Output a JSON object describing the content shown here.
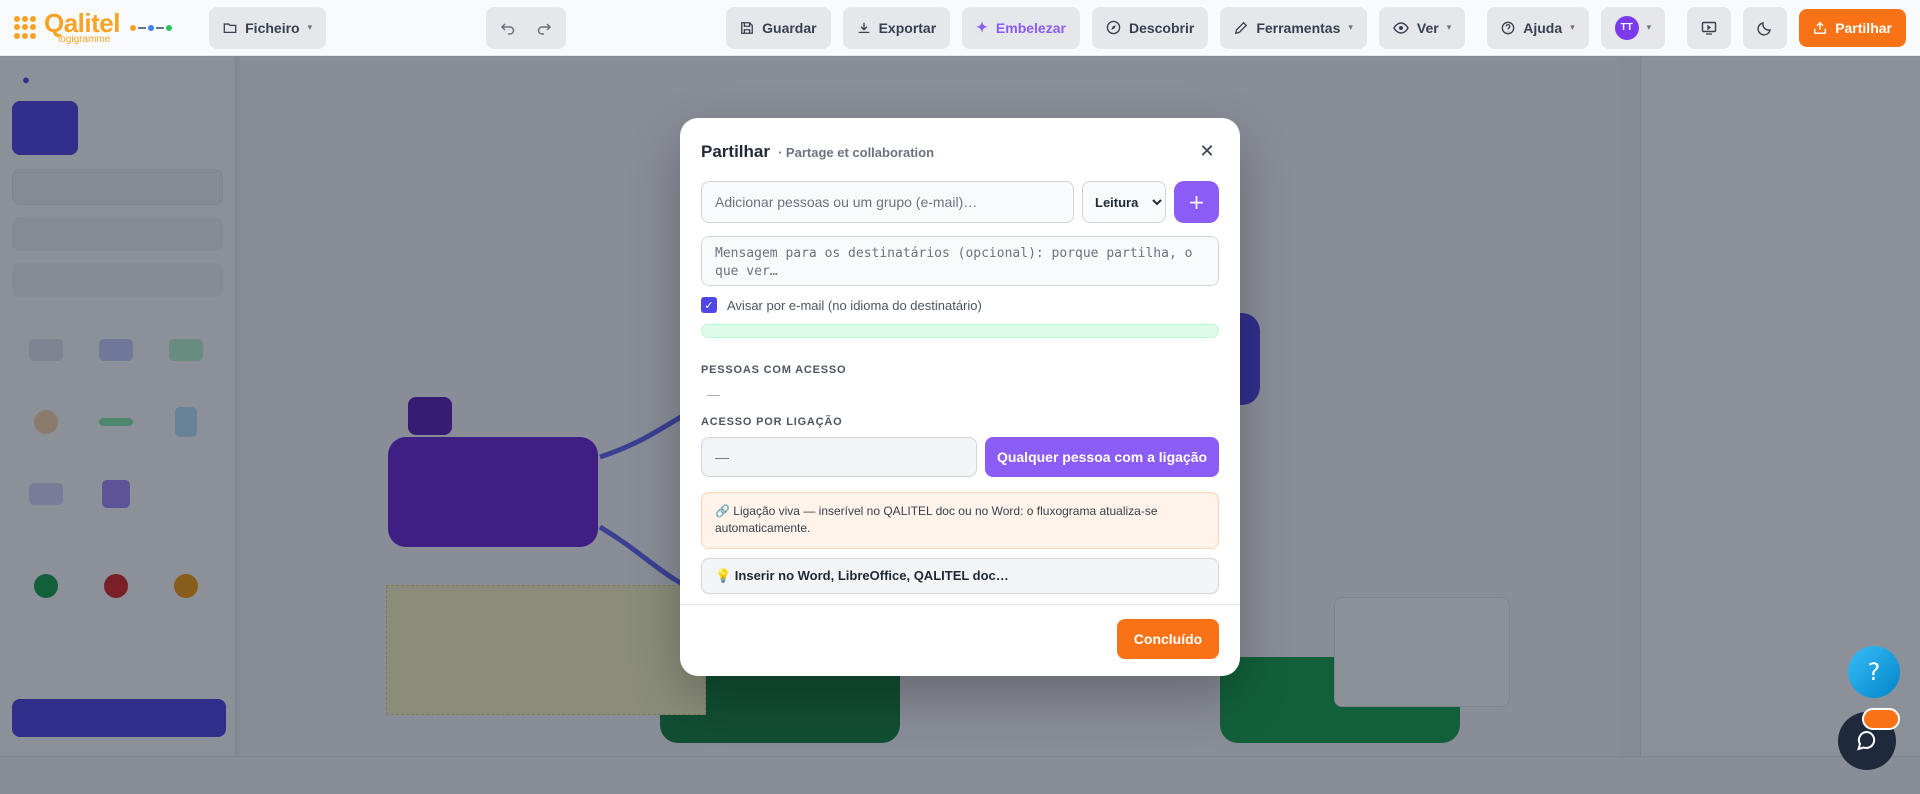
{
  "app": {
    "logo_name": "Qalitel",
    "logo_sub": "logigramme"
  },
  "toolbar": {
    "file_label": "Ficheiro",
    "save_label": "Guardar",
    "export_label": "Exportar",
    "embellish_label": "Embelezar",
    "discover_label": "Descobrir",
    "tools_label": "Ferramentas",
    "view_label": "Ver",
    "help_label": "Ajuda",
    "user_initials": "TT",
    "share_label": "Partilhar"
  },
  "modal": {
    "title": "Partilhar",
    "subtitle": "· Partage et collaboration",
    "email_placeholder": "Adicionar pessoas ou um grupo (e-mail)…",
    "role_options": [
      "Leitura"
    ],
    "role_selected": "Leitura",
    "add_button": "+",
    "message_placeholder": "Mensagem para os destinatários (opcional): porque partilha, o que ver…",
    "notify_label": "Avisar por e-mail (no idioma do destinatário)",
    "notify_checked": true,
    "people_section": "Pessoas com acesso",
    "people_empty": "—",
    "link_section": "Acesso por ligação",
    "link_value": "—",
    "link_button": "Qualquer pessoa com a ligação",
    "live_link_info": "🔗 Ligação viva — inserível no QALITEL doc ou no Word: o fluxograma atualiza-se automaticamente.",
    "embed_summary": "💡 Inserir no Word, LibreOffice, QALITEL doc…",
    "done_button": "Concluído"
  },
  "help_fab": "?",
  "colors": {
    "accent_purple": "#8b5cf6",
    "accent_orange": "#f97316",
    "brand_yellow": "#f7a325",
    "indigo": "#4f46e5"
  },
  "icons": {
    "close": "close-icon",
    "undo": "undo-icon",
    "redo": "redo-icon",
    "save": "save-icon",
    "export": "download-icon",
    "embellish": "sparkle-icon",
    "discover": "compass-icon",
    "tools": "pencil-icon",
    "view": "eye-icon",
    "help": "help-circle-icon",
    "present": "monitor-icon",
    "theme": "moon-icon",
    "share": "share-icon",
    "chat": "chat-icon"
  }
}
